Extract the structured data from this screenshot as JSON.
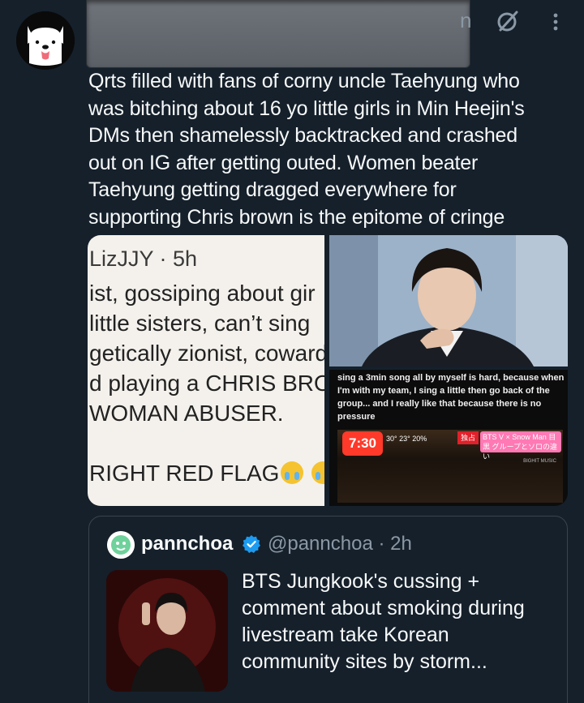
{
  "author": {
    "avatar": "white-dog-avatar",
    "handle_fragment": "n"
  },
  "icons": {
    "grok": "grok-icon",
    "more": "more-icon",
    "verified": "verified-badge-icon"
  },
  "tweet": {
    "lines": [
      "Qrts filled with fans of corny uncle Taehyung who",
      "was bitching about 16 yo little girls in Min Heejin's",
      "DMs then shamelessly backtracked and crashed",
      "out on IG after getting outed. Women beater",
      "Taehyung getting dragged everywhere for",
      "supporting Chris brown is the epitome of cringe"
    ]
  },
  "media": {
    "screenshot": {
      "name_line": "LizJJY · 5h",
      "lines": [
        "ist, gossiping about gir",
        "little sisters, can’t sing",
        "getically zionist, coward",
        "d playing a CHRIS BRO",
        "WOMAN ABUSER.",
        "RIGHT RED FLAG"
      ]
    },
    "caption": "sing a 3min song all by myself is hard, because when I'm with my team, I sing a little then go back of the group... and I really like that because there is no pressure",
    "tv": {
      "clock": "7:30",
      "clock_sub": "30° 23° 20%",
      "badge_red": "独占",
      "badge_pink": "BTS V × Snow Man 目黒 グループとソロの違い",
      "credit": "BIGHIT MUSIC"
    }
  },
  "quote": {
    "name": "pannchoa",
    "handle_time": "@pannchoa · 2h",
    "text_lines": [
      "BTS Jungkook's cussing +",
      "comment about smoking during",
      "livestream take Korean",
      "community sites by storm..."
    ]
  },
  "colors": {
    "background": "#15202b",
    "text": "#f7f9f9",
    "muted": "#8b98a5",
    "verified": "#1d9bf0",
    "border": "#38444d"
  }
}
